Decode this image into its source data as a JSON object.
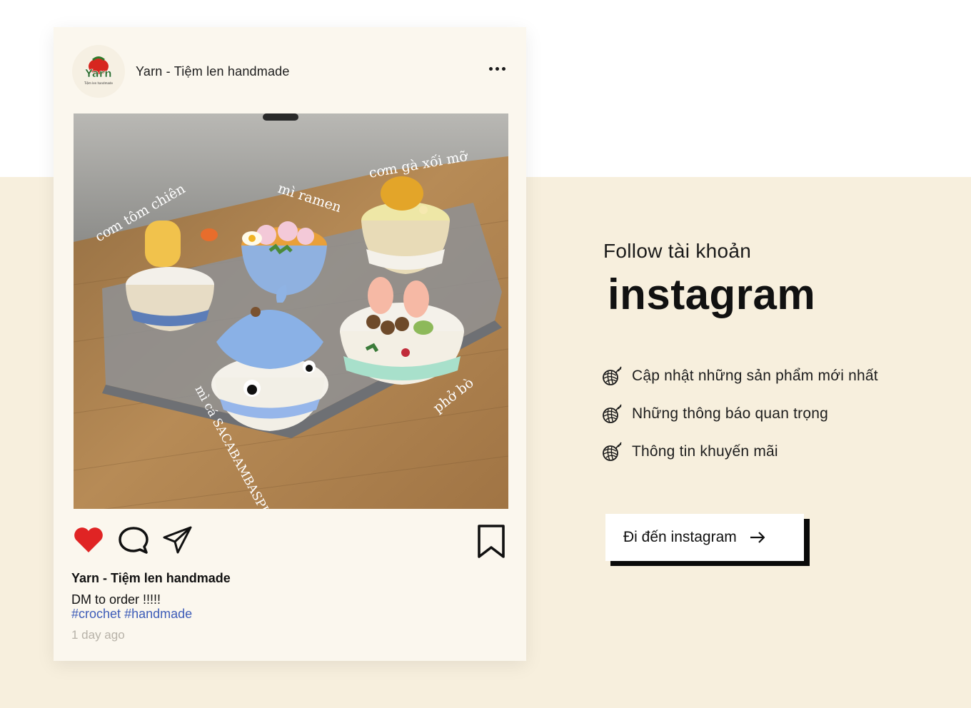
{
  "post": {
    "account_name": "Yarn - Tiệm len handmade",
    "avatar_logo_text": "Yarn",
    "avatar_logo_subtext": "Tiệm len handmade",
    "photo_labels": {
      "tom": "cơm tôm chiên",
      "ramen": "mì ramen",
      "ga": "cơm gà xối mỡ",
      "pho": "phở bò",
      "ca": "mì cá SACABAMBASPIS"
    },
    "caption_user": "Yarn - Tiệm len handmade",
    "caption_text": "DM to order !!!!!",
    "hashtags": [
      "#crochet",
      "#handmade"
    ],
    "timestamp": "1 day ago",
    "like_icon": "heart-icon",
    "like_color": "#e02424",
    "comment_icon": "comment-bubble-icon",
    "share_icon": "paper-plane-icon",
    "save_icon": "bookmark-icon",
    "more_icon": "more-dots-icon"
  },
  "panel": {
    "follow_label": "Follow tài khoản",
    "brand_title": "instagram",
    "bullet_icon": "yarn-ball-icon",
    "benefits": [
      "Cập nhật những sản phẩm mới nhất",
      "Những thông báo quan trọng",
      "Thông tin khuyến mãi"
    ],
    "cta_label": "Đi đến instagram",
    "cta_icon": "arrow-right-icon"
  },
  "colors": {
    "band": "#f7efdd",
    "card": "#fbf7ee",
    "hashtag": "#3d5cb8",
    "timestamp": "#b7b2a8"
  }
}
